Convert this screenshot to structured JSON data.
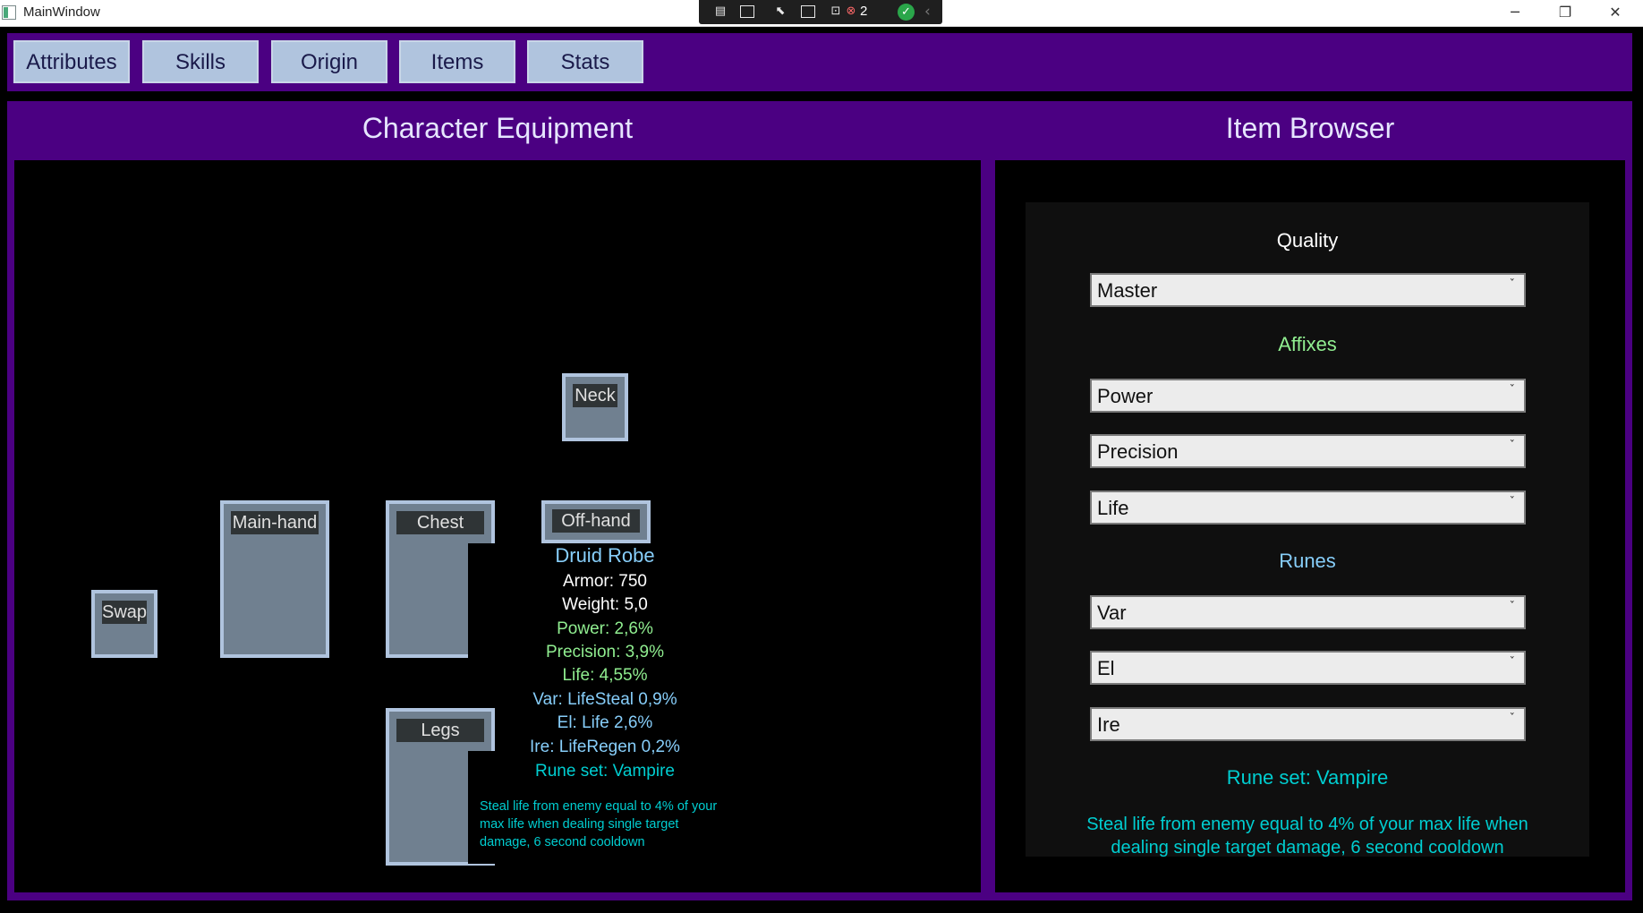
{
  "window": {
    "title": "MainWindow",
    "debug_toolbar": {
      "binding_failures": "2"
    },
    "controls": {
      "minimize": "─",
      "maximize": "❐",
      "close": "✕"
    }
  },
  "tabs": [
    "Attributes",
    "Skills",
    "Origin",
    "Items",
    "Stats"
  ],
  "equipment_panel": {
    "title": "Character Equipment",
    "slots": {
      "neck": "Neck",
      "main_hand": "Main-hand",
      "chest": "Chest",
      "off_hand": "Off-hand",
      "swap": "Swap",
      "legs": "Legs"
    },
    "tooltip": {
      "name": "Druid Robe",
      "armor": "Armor: 750",
      "weight": "Weight: 5,0",
      "affix1": "Power: 2,6%",
      "affix2": "Precision: 3,9%",
      "affix3": "Life: 4,55%",
      "rune1": "Var: LifeSteal 0,9%",
      "rune2": "El: Life 2,6%",
      "rune3": "Ire: LifeRegen 0,2%",
      "rune_set": "Rune set: Vampire",
      "rune_set_desc": "Steal life from enemy equal to 4% of your max life when dealing single target damage, 6 second cooldown"
    }
  },
  "item_browser": {
    "title": "Item Browser",
    "quality_label": "Quality",
    "quality_value": "Master",
    "affixes_label": "Affixes",
    "affixes": [
      "Power",
      "Precision",
      "Life"
    ],
    "runes_label": "Runes",
    "runes": [
      "Var",
      "El",
      "Ire"
    ],
    "rune_set": "Rune set: Vampire",
    "rune_set_desc": "Steal life from enemy equal to 4% of your max life when dealing single target damage, 6 second cooldown"
  },
  "colors": {
    "frame_purple": "#4b0082",
    "slot_fill": "#708090",
    "slot_border": "#b0c4de",
    "tooltip_name": "#87cefa",
    "affix_green": "#90ee90",
    "rune_blue": "#87cefa",
    "runeset_cyan": "#00ced1"
  }
}
